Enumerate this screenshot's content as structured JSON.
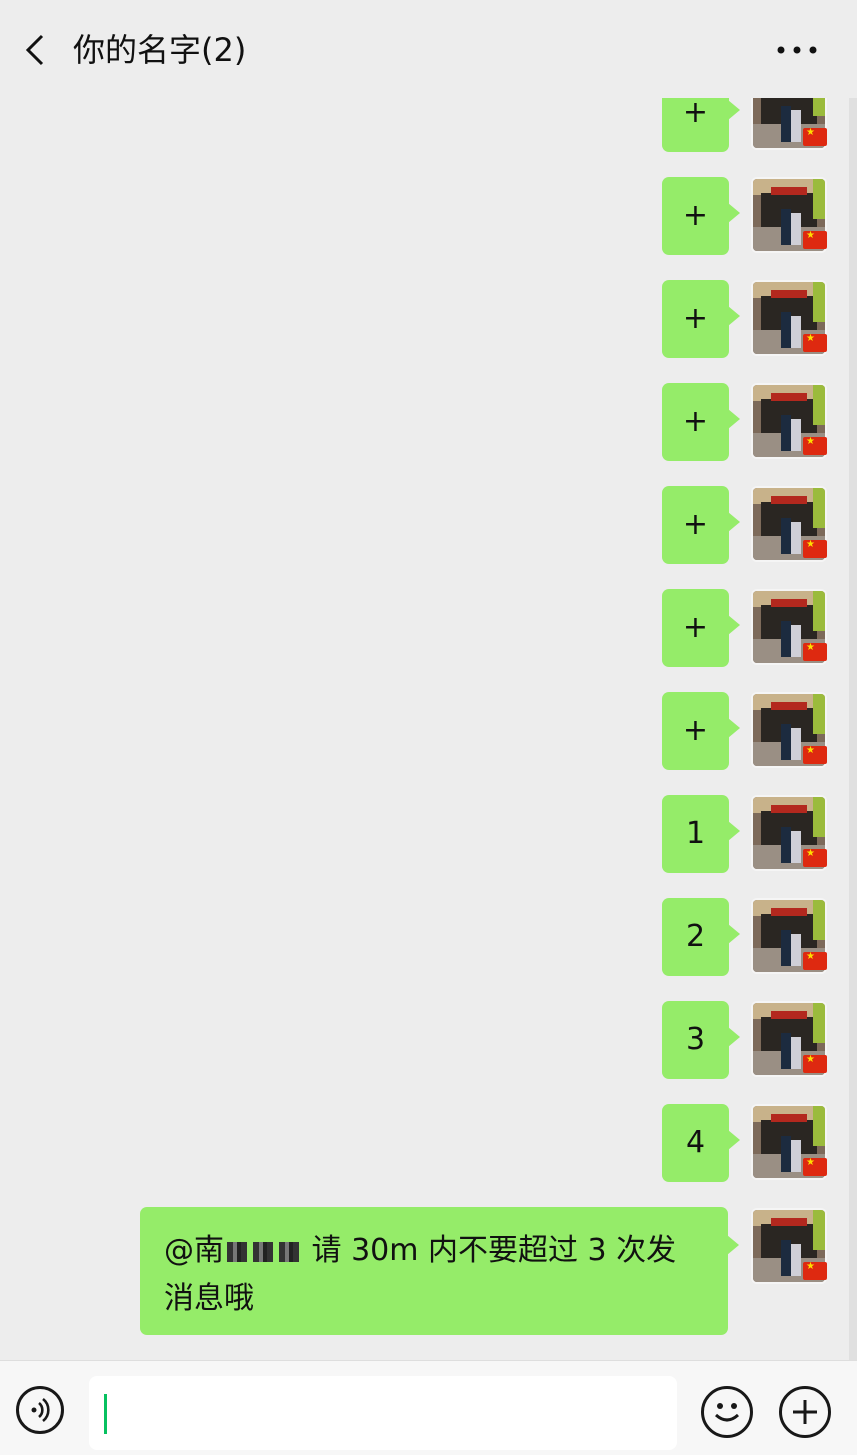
{
  "header": {
    "title": "你的名字(2)",
    "back_icon": "chevron-left-icon",
    "more_icon": "more-icon"
  },
  "messages": [
    {
      "text": "+"
    },
    {
      "text": "+"
    },
    {
      "text": "+"
    },
    {
      "text": "+"
    },
    {
      "text": "+"
    },
    {
      "text": "+"
    },
    {
      "text": "+"
    },
    {
      "text": "1"
    },
    {
      "text": "2"
    },
    {
      "text": "3"
    },
    {
      "text": "4"
    }
  ],
  "last_message": {
    "mention": "@南",
    "line1_rest": "请 30m 内不要超过 3 次发",
    "line2": "消息哦"
  },
  "bottom_bar": {
    "voice_icon": "voice-icon",
    "emoji_icon": "emoji-icon",
    "plus_icon": "plus-circle-icon",
    "input_value": ""
  },
  "colors": {
    "bubble": "#95ec69",
    "background": "#ededed",
    "caret": "#07c160"
  }
}
